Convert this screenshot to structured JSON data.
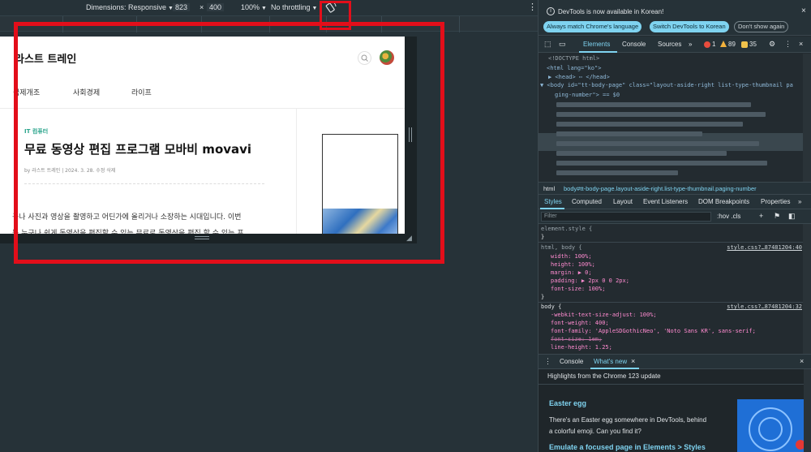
{
  "emulation": {
    "dimensions_label": "Dimensions: Responsive",
    "width": "823",
    "x_sep": "×",
    "height": "400",
    "zoom": "100%",
    "throttling": "No throttling",
    "more": "⋮"
  },
  "blog": {
    "title": "라스트 트레인",
    "nav": [
      "국제개조",
      "사회경제",
      "라이프"
    ],
    "category": "IT 컴퓨터",
    "post_title": "무료 동영상 편집 프로그램 모바비 movavi",
    "meta": "by 라스트 트레인   |   2024. 3. 28. 수정 삭제",
    "body_line1": "구나 사진과 영상을 촬영하고 어딘가에 올리거나 소장하는 시대입니다. 이번",
    "body_line2": "는 누구나 쉽게 동영상을 편집할 수 있는 무료로 동영상을 편집 할 수 있는 프"
  },
  "devtools": {
    "info_text": "DevTools is now available in Korean!",
    "btn_match": "Always match Chrome's language",
    "btn_switch": "Switch DevTools to Korean",
    "btn_dont": "Don't show again",
    "tabs": [
      "Elements",
      "Console",
      "Sources"
    ],
    "more_tabs": "»",
    "errors": "1",
    "warnings": "89",
    "infos": "35",
    "dom": {
      "doctype": "<!DOCTYPE html>",
      "html_open": "<html lang=\"ko\">",
      "head": "▶ <head> ⋯ </head>",
      "body_l1": "▼ <body id=\"tt-body-page\" class=\"layout-aside-right list-type-thumbnail pa",
      "body_l2": "ging-number\"> == $0"
    },
    "crumbs": {
      "html": "html",
      "body": "body#tt-body-page.layout-aside-right.list-type-thumbnail.paging-number"
    },
    "style_tabs": [
      "Styles",
      "Computed",
      "Layout",
      "Event Listeners",
      "DOM Breakpoints",
      "Properties"
    ],
    "filter_placeholder": "Filter",
    "filter_tools": ":hov  .cls",
    "styles": {
      "element_style": "element.style {",
      "close": "}",
      "rule1_selector": "html, body {",
      "rule1_src": "style.css?…87481204:40",
      "rule1_props": [
        "width: 100%;",
        "height: 100%;",
        "margin: ▶ 0;",
        "padding: ▶ 2px 0 0 2px;",
        "font-size: 100%;"
      ],
      "rule2_selector": "body {",
      "rule2_src": "style.css?…87481204:32",
      "rule2_props": [
        "-webkit-text-size-adjust: 100%;",
        "font-weight: 400;",
        "font-family: 'AppleSDGothicNeo', 'Noto Sans KR', sans-serif;",
        "font-size: 1em;",
        "line-height: 1.25;",
        "color: #555;"
      ]
    },
    "drawer_tabs": [
      "Console",
      "What's new"
    ],
    "drawer": {
      "highlight": "Highlights from the Chrome 123 update",
      "h1": "Easter egg",
      "p1": "There's an Easter egg somewhere in DevTools, behind",
      "p2": "a colorful  emoji. Can you find it?",
      "h2": "Emulate a focused page in Elements > Styles"
    }
  },
  "colors": {
    "accent": "#7fd3f0",
    "annotation_red": "#e30e1a",
    "bg": "#263238"
  }
}
